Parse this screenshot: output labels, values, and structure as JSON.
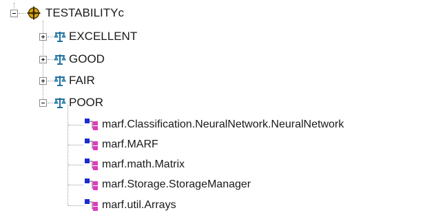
{
  "tree": {
    "root": {
      "label": "TESTABILITYc",
      "icon": "crosshair-target-icon",
      "expanded": true
    },
    "categories": [
      {
        "label": "EXCELLENT",
        "icon": "scales-icon",
        "expanded": false
      },
      {
        "label": "GOOD",
        "icon": "scales-icon",
        "expanded": false
      },
      {
        "label": "FAIR",
        "icon": "scales-icon",
        "expanded": false
      },
      {
        "label": "POOR",
        "icon": "scales-icon",
        "expanded": true
      }
    ],
    "poor_items": [
      {
        "label": "marf.Classification.NeuralNetwork.NeuralNetwork",
        "icon": "class-hierarchy-icon"
      },
      {
        "label": "marf.MARF",
        "icon": "class-hierarchy-icon"
      },
      {
        "label": "marf.math.Matrix",
        "icon": "class-hierarchy-icon"
      },
      {
        "label": "marf.Storage.StorageManager",
        "icon": "class-hierarchy-icon"
      },
      {
        "label": "marf.util.Arrays",
        "icon": "class-hierarchy-icon"
      }
    ]
  },
  "colors": {
    "root_icon": "#8b6d00",
    "scales_icon": "#2e7fa8",
    "class_icon_blue": "#1a2bd6",
    "class_icon_pink": "#e03ac0"
  }
}
